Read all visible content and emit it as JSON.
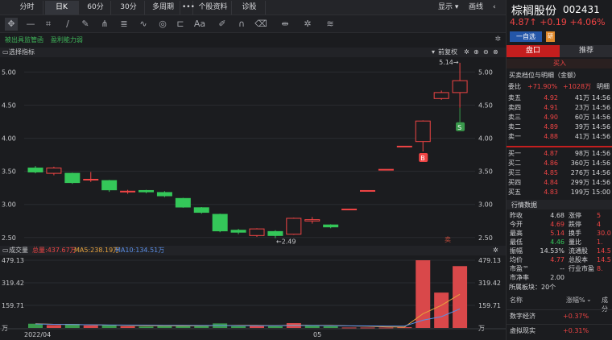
{
  "top_tabs": [
    "分时",
    "日K",
    "60分",
    "30分",
    "多周期",
    "•••",
    "个股资料",
    "诊股"
  ],
  "top_right": {
    "display": "显示",
    "draw": "画线"
  },
  "tags": [
    "被出具监管函",
    "盈利能力弱"
  ],
  "indicator_bar": {
    "left": "选择指标",
    "right": "前复权"
  },
  "kline": {
    "y_ticks": [
      "5.00",
      "4.50",
      "4.00",
      "3.50",
      "3.00",
      "2.50"
    ],
    "y_range": [
      2.4,
      5.2
    ],
    "high_label": "5.14",
    "low_label": "2.49",
    "marker_b": "B",
    "marker_s": "S",
    "marker_sell": "卖",
    "candles": [
      {
        "o": 3.55,
        "c": 3.49,
        "h": 3.58,
        "l": 3.47
      },
      {
        "o": 3.47,
        "c": 3.55,
        "h": 3.57,
        "l": 3.44
      },
      {
        "o": 3.47,
        "c": 3.33,
        "h": 3.48,
        "l": 3.31
      },
      {
        "o": 3.37,
        "c": 3.38,
        "h": 3.49,
        "l": 3.34
      },
      {
        "o": 3.36,
        "c": 3.22,
        "h": 3.37,
        "l": 3.19
      },
      {
        "o": 3.19,
        "c": 3.2,
        "h": 3.22,
        "l": 3.16
      },
      {
        "o": 3.21,
        "c": 3.19,
        "h": 3.22,
        "l": 3.17
      },
      {
        "o": 3.18,
        "c": 3.13,
        "h": 3.2,
        "l": 3.11
      },
      {
        "o": 3.09,
        "c": 2.96,
        "h": 3.1,
        "l": 2.95
      },
      {
        "o": 2.95,
        "c": 2.88,
        "h": 2.96,
        "l": 2.86
      },
      {
        "o": 2.85,
        "c": 2.6,
        "h": 2.86,
        "l": 2.58
      },
      {
        "o": 2.61,
        "c": 2.58,
        "h": 2.63,
        "l": 2.55
      },
      {
        "o": 2.53,
        "c": 2.63,
        "h": 2.64,
        "l": 2.51
      },
      {
        "o": 2.59,
        "c": 2.53,
        "h": 2.61,
        "l": 2.49
      },
      {
        "o": 2.55,
        "c": 2.79,
        "h": 2.8,
        "l": 2.54
      },
      {
        "o": 2.75,
        "c": 2.77,
        "h": 2.81,
        "l": 2.71
      },
      {
        "o": 2.69,
        "c": 2.66,
        "h": 2.7,
        "l": 2.64
      },
      {
        "o": 2.93,
        "c": 2.93,
        "h": 2.93,
        "l": 2.93
      },
      {
        "o": 3.21,
        "c": 3.21,
        "h": 3.21,
        "l": 3.21
      },
      {
        "o": 3.53,
        "c": 3.53,
        "h": 3.53,
        "l": 3.53
      },
      {
        "o": 3.88,
        "c": 3.88,
        "h": 3.88,
        "l": 3.88
      },
      {
        "o": 3.95,
        "c": 4.26,
        "h": 4.27,
        "l": 3.8
      },
      {
        "o": 4.6,
        "c": 4.69,
        "h": 4.72,
        "l": 4.58
      },
      {
        "o": 4.69,
        "c": 4.87,
        "h": 5.14,
        "l": 4.46
      }
    ]
  },
  "volume_bar": {
    "title": "成交量",
    "total": "总量:437.67万",
    "ma5": "MA5:238.19万",
    "ma10": "MA10:134.51万"
  },
  "volume": {
    "y_ticks": [
      "479.13",
      "319.42",
      "159.71",
      "万"
    ],
    "x_labels": [
      "2022/04",
      "05"
    ],
    "max": 479.13,
    "bars": [
      {
        "v": 30,
        "up": false
      },
      {
        "v": 20,
        "up": true
      },
      {
        "v": 28,
        "up": false
      },
      {
        "v": 18,
        "up": true
      },
      {
        "v": 22,
        "up": false
      },
      {
        "v": 12,
        "up": true
      },
      {
        "v": 10,
        "up": false
      },
      {
        "v": 14,
        "up": false
      },
      {
        "v": 18,
        "up": false
      },
      {
        "v": 15,
        "up": false
      },
      {
        "v": 32,
        "up": false
      },
      {
        "v": 12,
        "up": false
      },
      {
        "v": 14,
        "up": true
      },
      {
        "v": 12,
        "up": false
      },
      {
        "v": 34,
        "up": true
      },
      {
        "v": 16,
        "up": false
      },
      {
        "v": 12,
        "up": false
      },
      {
        "v": 3,
        "up": true
      },
      {
        "v": 3,
        "up": true
      },
      {
        "v": 3,
        "up": true
      },
      {
        "v": 5,
        "up": true
      },
      {
        "v": 479.13,
        "up": true
      },
      {
        "v": 250,
        "up": true
      },
      {
        "v": 437.67,
        "up": true
      }
    ],
    "ma5": [
      30,
      26,
      24,
      22,
      20,
      18,
      16,
      15,
      14,
      15,
      17,
      18,
      18,
      16,
      20,
      18,
      18,
      14,
      12,
      8,
      6,
      100,
      160,
      238.19
    ],
    "ma10": [
      28,
      26,
      24,
      22,
      21,
      20,
      19,
      18,
      18,
      17,
      17,
      16,
      16,
      16,
      17,
      17,
      16,
      15,
      14,
      13,
      13,
      55,
      80,
      134.51
    ]
  },
  "stock": {
    "name": "棕榈股份",
    "code": "002431",
    "price": "4.87",
    "arrow": "↑",
    "change": "+0.19",
    "pct": "+4.06%"
  },
  "fav_button": "一自选",
  "fav_badge": "研",
  "right_tabs": {
    "panel": "盘口",
    "recommend": "推荐"
  },
  "buy_sell": "买入",
  "order_title": "买卖档位与明细（金额）",
  "weibi": {
    "label": "委比",
    "pct": "+71.90%",
    "diff": "+1028万",
    "detail": "明细"
  },
  "asks": [
    {
      "label": "卖五",
      "price": "4.92",
      "amount": "41万",
      "time": "14:56"
    },
    {
      "label": "卖四",
      "price": "4.91",
      "amount": "23万",
      "time": "14:56"
    },
    {
      "label": "卖三",
      "price": "4.90",
      "amount": "60万",
      "time": "14:56"
    },
    {
      "label": "卖二",
      "price": "4.89",
      "amount": "39万",
      "time": "14:56"
    },
    {
      "label": "卖一",
      "price": "4.88",
      "amount": "41万",
      "time": "14:56"
    }
  ],
  "bids": [
    {
      "label": "买一",
      "price": "4.87",
      "amount": "98万",
      "time": "14:56"
    },
    {
      "label": "买二",
      "price": "4.86",
      "amount": "360万",
      "time": "14:56"
    },
    {
      "label": "买三",
      "price": "4.85",
      "amount": "276万",
      "time": "14:56"
    },
    {
      "label": "买四",
      "price": "4.84",
      "amount": "299万",
      "time": "14:56"
    },
    {
      "label": "买五",
      "price": "4.83",
      "amount": "199万",
      "time": "15:00"
    }
  ],
  "stats_title": "行情数据",
  "stats": [
    {
      "a": "昨收",
      "b": "4.68",
      "bc": "white",
      "c": "涨停",
      "d": "5"
    },
    {
      "a": "今开",
      "b": "4.69",
      "bc": "red",
      "c": "跌停",
      "d": "4"
    },
    {
      "a": "最高",
      "b": "5.14",
      "bc": "red",
      "c": "换手",
      "d": "30.0"
    },
    {
      "a": "最低",
      "b": "4.46",
      "bc": "green",
      "c": "量比",
      "d": "1."
    },
    {
      "a": "振幅",
      "b": "14.53%",
      "bc": "white",
      "c": "流通股",
      "d": "14.5"
    },
    {
      "a": "均价",
      "b": "4.77",
      "bc": "red",
      "c": "总股本",
      "d": "14.5"
    },
    {
      "a": "市盈™",
      "b": "--",
      "bc": "white",
      "c": "行业市盈",
      "d": "8."
    },
    {
      "a": "市净率",
      "b": "2.00",
      "bc": "white",
      "c": "",
      "d": ""
    }
  ],
  "sector": {
    "title": "所属板块：20个",
    "col1": "名称",
    "col2": "涨幅%",
    "col3": "成分"
  },
  "sectors": [
    {
      "name": "数字经济",
      "pct": "+0.37%"
    },
    {
      "name": "虚拟现实",
      "pct": "+0.31%"
    }
  ],
  "colors": {
    "up": "#ef4444",
    "down": "#34c759",
    "ma5": "#e8a33d",
    "ma10": "#5a8ee6",
    "accent": "#c41e1e"
  }
}
